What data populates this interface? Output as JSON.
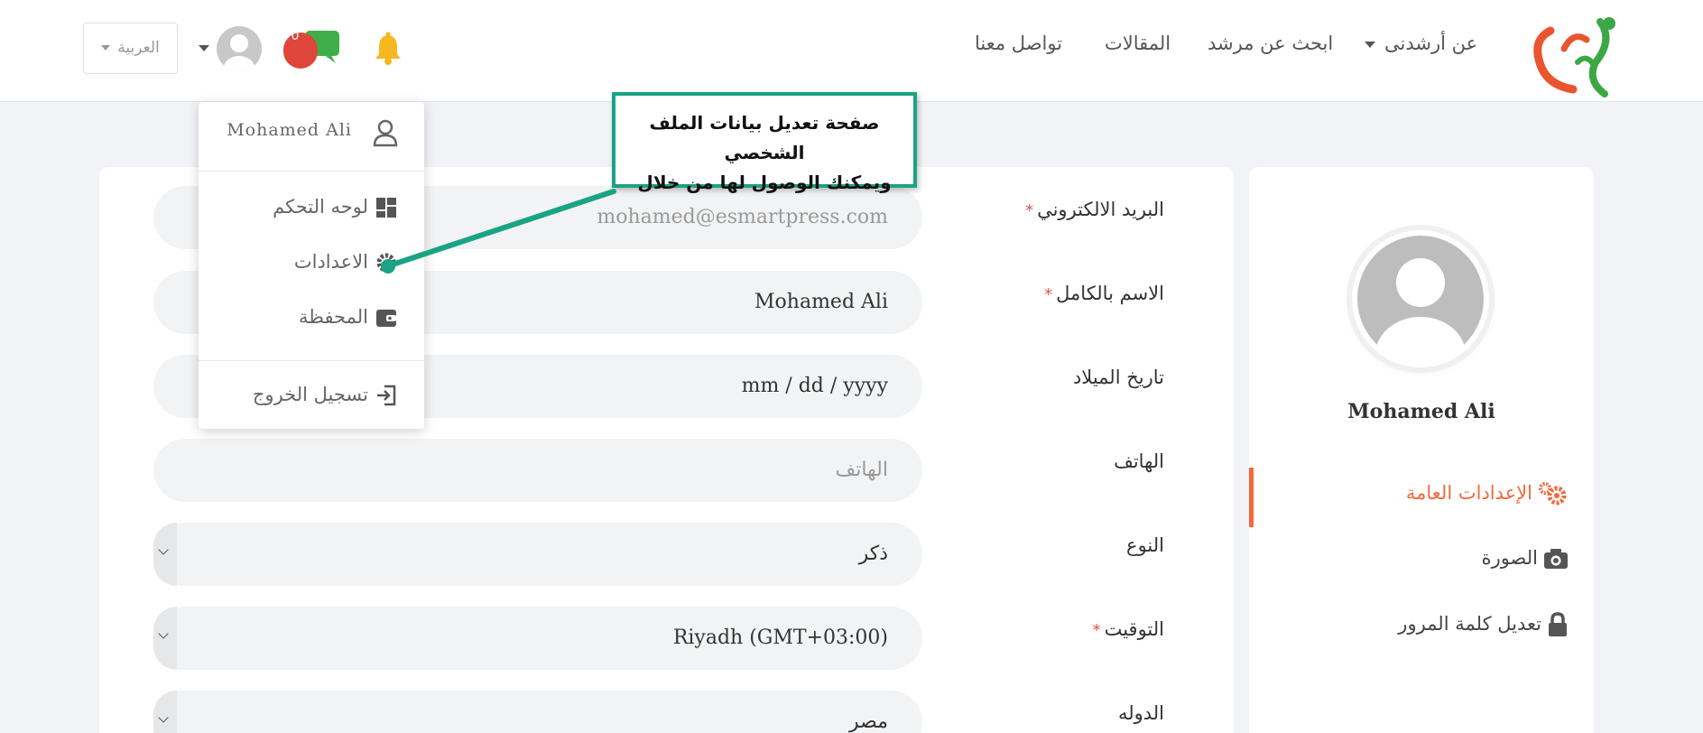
{
  "header": {
    "nav": {
      "about": "عن أرشدنى",
      "search_mentor": "ابحث عن مرشد",
      "articles": "المقالات",
      "contact": "تواصل معنا"
    },
    "messages_count": "0",
    "language": "العربية"
  },
  "dropdown": {
    "user_name": "Mohamed Ali",
    "items": [
      {
        "label": "لوحه التحكم",
        "icon": "dashboard-icon"
      },
      {
        "label": "الاعدادات",
        "icon": "gear-icon"
      },
      {
        "label": "المحفظة",
        "icon": "wallet-icon"
      }
    ],
    "logout": "تسجيل الخروج"
  },
  "callout": {
    "line1": "صفحة تعديل بيانات الملف الشخصي",
    "line2": "ويمكنك الوصول لها من خلال"
  },
  "form": {
    "email_label": "البريد الالكتروني",
    "email_value": "mohamed@esmartpress.com",
    "name_label": "الاسم بالكامل",
    "name_value": "Mohamed Ali",
    "birth_label": "تاريخ الميلاد",
    "birth_placeholder": "mm / dd / yyyy",
    "phone_label": "الهاتف",
    "phone_placeholder": "الهاتف",
    "gender_label": "النوع",
    "gender_value": "ذكر",
    "timezone_label": "التوقيت",
    "timezone_value": "Riyadh (GMT+03:00)",
    "country_label": "الدوله",
    "country_value": "مصر",
    "required_mark": "*"
  },
  "sidebar": {
    "name": "Mohamed Ali",
    "items": [
      {
        "label": "الإعدادات العامة",
        "icon": "gears-icon",
        "active": true
      },
      {
        "label": "الصورة",
        "icon": "camera-icon",
        "active": false
      },
      {
        "label": "تعديل كلمة المرور",
        "icon": "lock-icon",
        "active": false
      }
    ]
  },
  "colors": {
    "accent": "#f26a3c",
    "callout_border": "#1aa384",
    "required": "#d9534f"
  }
}
